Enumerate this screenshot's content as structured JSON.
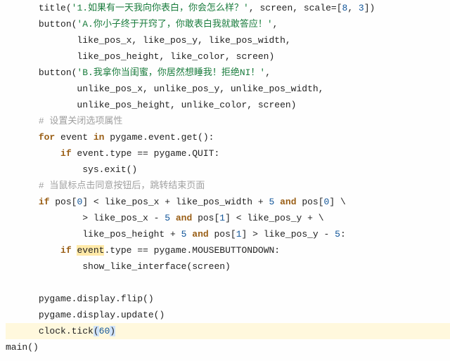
{
  "colors": {
    "keyword": "#9a5f16",
    "string": "#1a7c3d",
    "number": "#115599",
    "comment": "#a0a0a0",
    "hl_y": "#ffe9a8",
    "hl_b": "#cfe3fb",
    "line_bg": "#fff8dd"
  },
  "t": {
    "title_fn": "title",
    "title_str": "'1.如果有一天我向你表白，你会怎么样？'",
    "title_args": ", screen, ",
    "scale_kw": "scale",
    "scale_eq": "=[",
    "scale_a": "8",
    "scale_comma": ", ",
    "scale_b": "3",
    "scale_close": "])",
    "button1_fn": "button(",
    "button1_str": "'A.你小子终于开窍了，你敢表白我就敢答应！'",
    "button1_comma": ",",
    "like_args1": "like_pos_x, like_pos_y, like_pos_width,",
    "like_args2": "like_pos_height, like_color, screen)",
    "button2_fn": "button(",
    "button2_str": "'B.我拿你当闺蜜，你居然想睡我！拒绝NI！'",
    "button2_comma": ",",
    "unlike_args1": "unlike_pos_x, unlike_pos_y, unlike_pos_width,",
    "unlike_args2": "unlike_pos_height, unlike_color, screen)",
    "comment_close": "# 设置关闭选项属性",
    "for_kw": "for",
    "in_kw": "in",
    "for_iter": " event ",
    "for_src": " pygame.event.get():",
    "if_kw": "if",
    "cond1": " event.type == pygame.QUIT:",
    "sys_exit": "sys.exit()",
    "comment_click": "# 当鼠标点击同意按钮后，跳转结束页面",
    "if2_a": " pos[",
    "zero": "0",
    "one": "1",
    "five": "5",
    "if2_b": "] < like_pos_x + like_pos_width + ",
    "and_kw": "and",
    "if2_c": " pos[",
    "if2_d": "] \\",
    "if2_e": "> like_pos_x - ",
    "if2_f": " pos[",
    "if2_g": "] < like_pos_y + \\",
    "if2_h": "like_pos_height + ",
    "if2_i": " pos[",
    "if2_j": "] > like_pos_y - ",
    "colon": ":",
    "if3_a": " ",
    "event_hl": "event",
    "if3_b": ".type == pygame.MOUSEBUTTONDOWN:",
    "show_like": "show_like_interface(screen)",
    "flip": "pygame.display.flip()",
    "update": "pygame.display.update()",
    "clock_a": "clock.tick",
    "clock_paren_open": "(",
    "sixty": "60",
    "clock_paren_close": ")",
    "main_call": "main()"
  }
}
